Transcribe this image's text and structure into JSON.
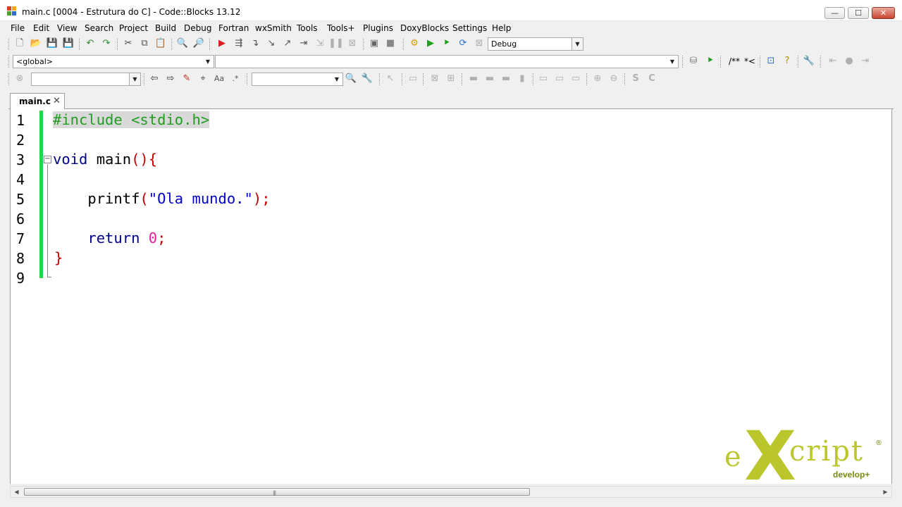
{
  "window": {
    "title": "main.c [0004 - Estrutura do C] - Code::Blocks 13.12",
    "minimize_glyph": "—",
    "maximize_glyph": "☐",
    "close_glyph": "✕"
  },
  "menu": [
    "File",
    "Edit",
    "View",
    "Search",
    "Project",
    "Build",
    "Debug",
    "Fortran",
    "wxSmith",
    "Tools",
    "Tools+",
    "Plugins",
    "DoxyBlocks",
    "Settings",
    "Help"
  ],
  "toolbar": {
    "build_target": "Debug",
    "scope": "<global>",
    "function": "",
    "doxy_block": "/**",
    "doxy_line": "*<",
    "search_text": "",
    "search_option": "",
    "font_glyph": "Aa"
  },
  "editor": {
    "tab_label": "main.c",
    "tab_close": "✕",
    "fold_glyph": "−",
    "lines": [
      {
        "no": "1",
        "tokens": [
          {
            "t": "#include <stdio.h>",
            "c": "pre"
          }
        ]
      },
      {
        "no": "2",
        "tokens": []
      },
      {
        "no": "3",
        "tokens": [
          {
            "t": "void ",
            "c": "kw"
          },
          {
            "t": "main",
            "c": "id"
          },
          {
            "t": "(){",
            "c": "op"
          }
        ]
      },
      {
        "no": "4",
        "tokens": []
      },
      {
        "no": "5",
        "tokens": [
          {
            "t": "    printf",
            "c": "id"
          },
          {
            "t": "(",
            "c": "op"
          },
          {
            "t": "\"Ola mundo.\"",
            "c": "str"
          },
          {
            "t": ");",
            "c": "op"
          }
        ]
      },
      {
        "no": "6",
        "tokens": []
      },
      {
        "no": "7",
        "tokens": [
          {
            "t": "    return ",
            "c": "kw"
          },
          {
            "t": "0",
            "c": "num"
          },
          {
            "t": ";",
            "c": "op"
          }
        ]
      },
      {
        "no": "8",
        "tokens": [
          {
            "t": "}",
            "c": "op"
          }
        ]
      },
      {
        "no": "9",
        "tokens": []
      }
    ]
  },
  "scroll": {
    "left_arrow": "◀",
    "right_arrow": "▶",
    "grip": "|||"
  },
  "watermark": {
    "brand_left": "e",
    "brand_x": "X",
    "brand_right": "cript",
    "registered": "®",
    "tagline": "develop+"
  },
  "colors": {
    "preprocessor": "#1f9d1f",
    "keyword": "#00008b",
    "operator": "#c00000",
    "string": "#0000c8",
    "number": "#e0209a",
    "change_bar": "#2bd14a",
    "watermark": "#b5c21a"
  }
}
